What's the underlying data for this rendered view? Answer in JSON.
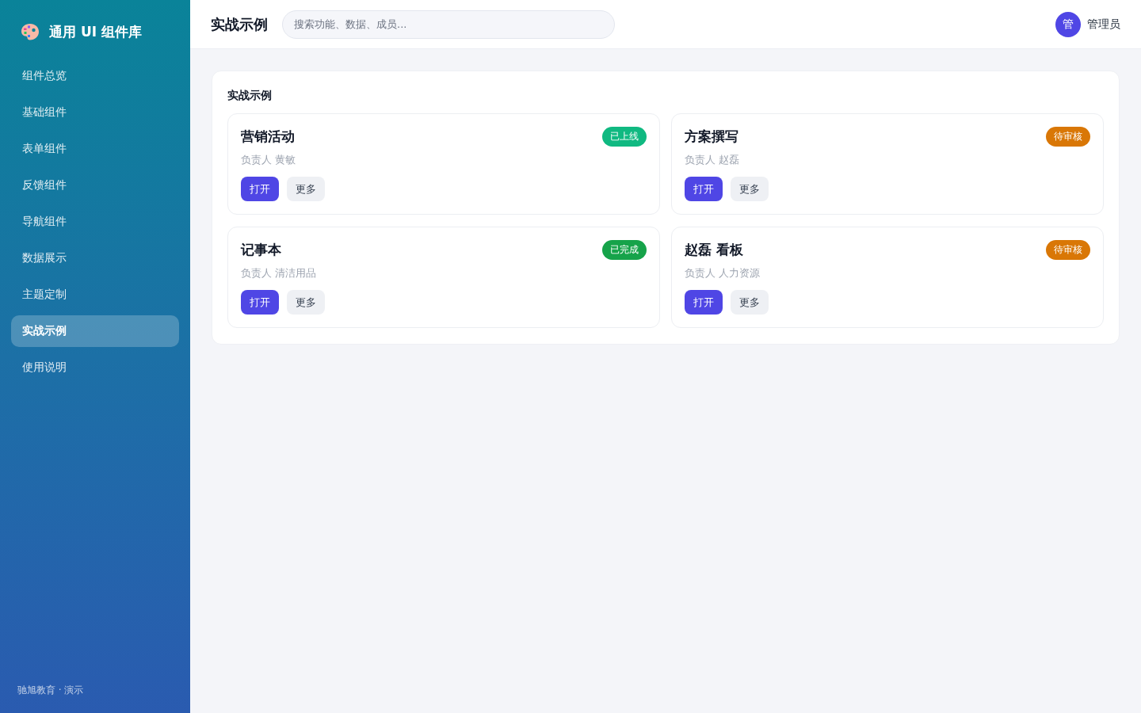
{
  "sidebar": {
    "brand": "通用 UI 组件库",
    "items": [
      {
        "label": "组件总览",
        "selected": false
      },
      {
        "label": "基础组件",
        "selected": false
      },
      {
        "label": "表单组件",
        "selected": false
      },
      {
        "label": "反馈组件",
        "selected": false
      },
      {
        "label": "导航组件",
        "selected": false
      },
      {
        "label": "数据展示",
        "selected": false
      },
      {
        "label": "主题定制",
        "selected": false
      },
      {
        "label": "实战示例",
        "selected": true
      },
      {
        "label": "使用说明",
        "selected": false
      }
    ],
    "footer": "驰旭教育 · 演示"
  },
  "header": {
    "title": "实战示例",
    "search": {
      "placeholder": "搜索功能、数据、成员..."
    },
    "user": {
      "avatar": "管",
      "name": "管理员"
    }
  },
  "panel": {
    "title": "实战示例",
    "cards": [
      {
        "title": "营销活动",
        "status": {
          "label": "已上线",
          "color": "#10b981"
        },
        "owner": "负责人 黄敏",
        "buttons": [
          {
            "label": "打开",
            "kind": "primary"
          },
          {
            "label": "更多",
            "kind": "secondary"
          }
        ]
      },
      {
        "title": "方案撰写",
        "status": {
          "label": "待审核",
          "color": "#d97706"
        },
        "owner": "负责人 赵磊",
        "buttons": [
          {
            "label": "打开",
            "kind": "primary"
          },
          {
            "label": "更多",
            "kind": "secondary"
          }
        ]
      },
      {
        "title": "记事本",
        "status": {
          "label": "已完成",
          "color": "#16a34a"
        },
        "owner": "负责人 清洁用品",
        "buttons": [
          {
            "label": "打开",
            "kind": "primary"
          },
          {
            "label": "更多",
            "kind": "secondary"
          }
        ]
      },
      {
        "title": "赵磊 看板",
        "status": {
          "label": "待审核",
          "color": "#d97706"
        },
        "owner": "负责人 人力资源",
        "buttons": [
          {
            "label": "打开",
            "kind": "primary"
          },
          {
            "label": "更多",
            "kind": "secondary"
          }
        ]
      }
    ]
  }
}
